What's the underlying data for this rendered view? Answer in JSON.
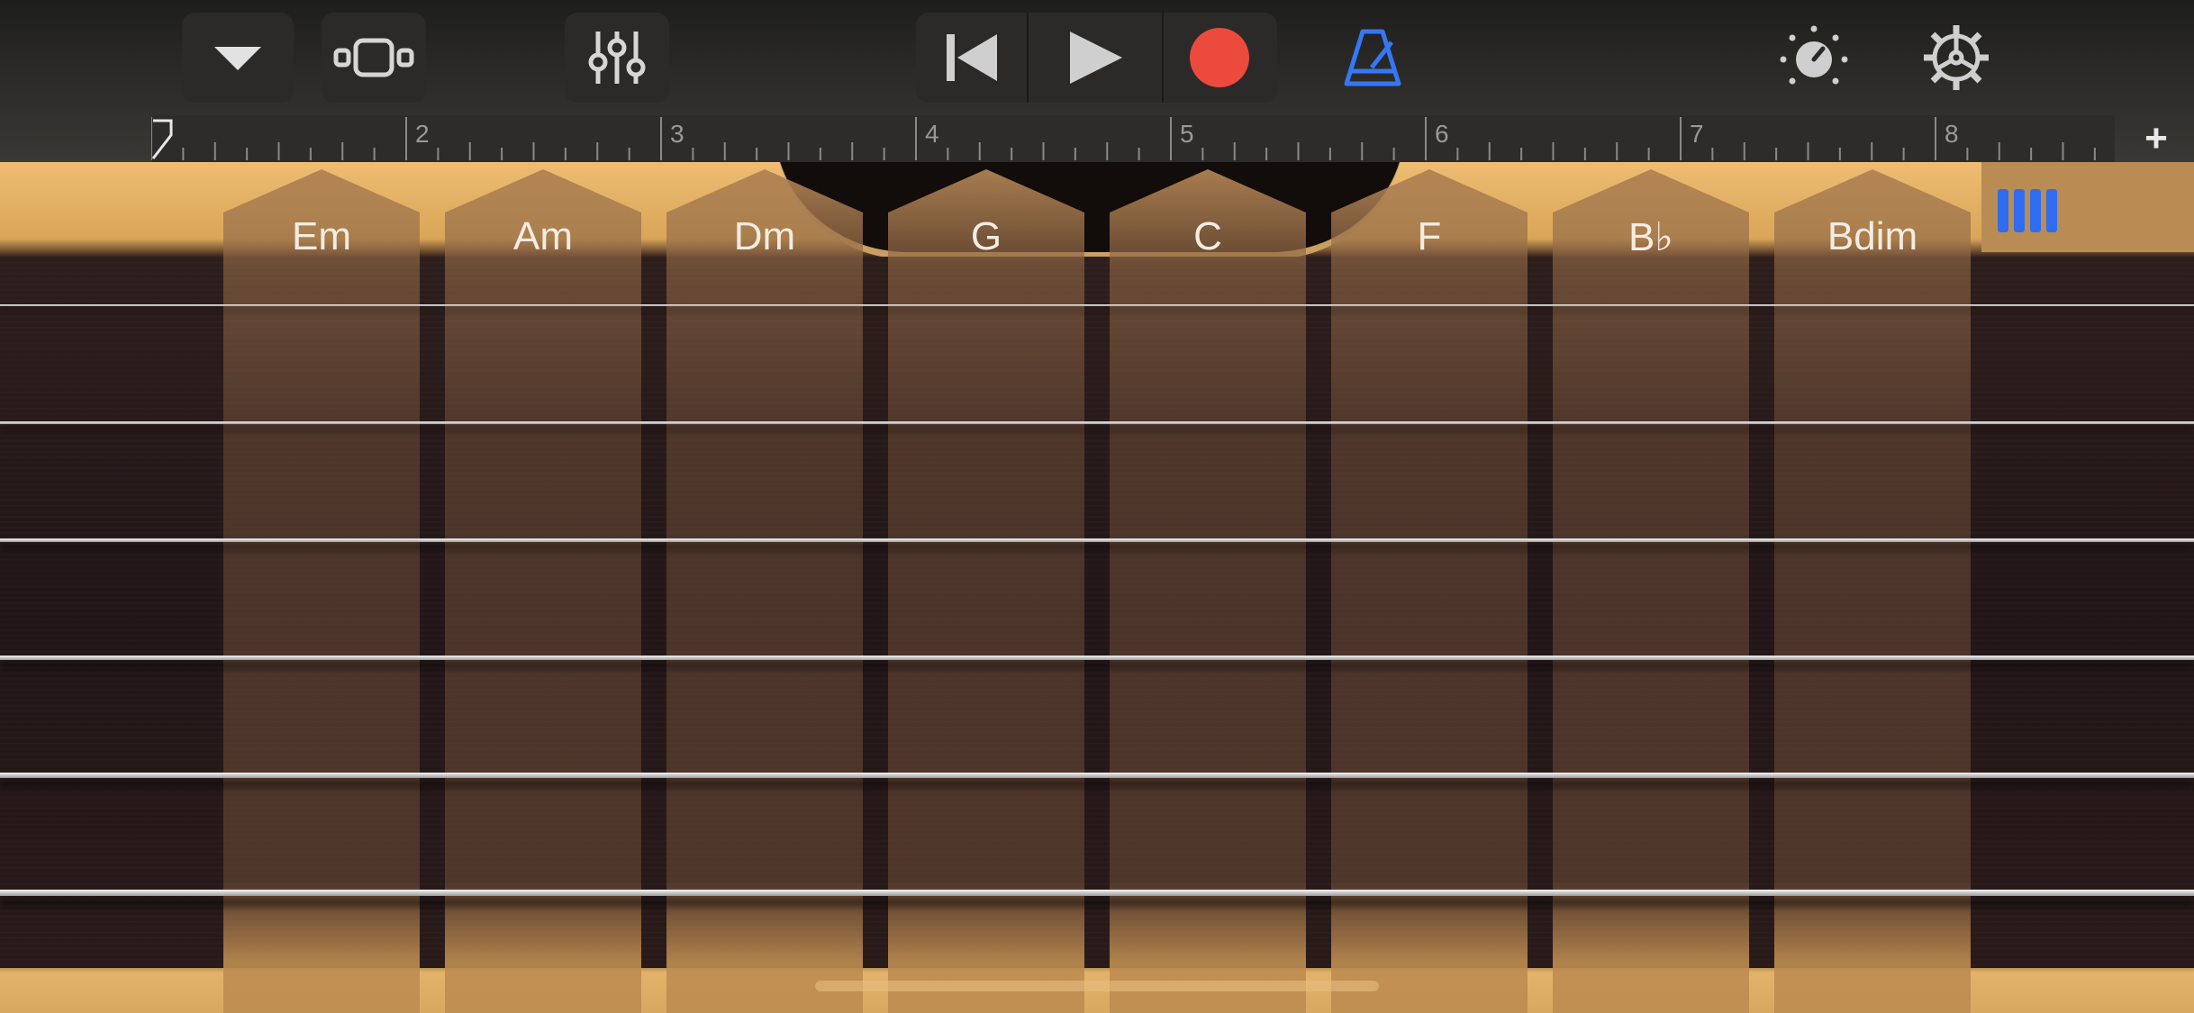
{
  "toolbar": {
    "buttons": [
      {
        "name": "browser-menu-button",
        "icon": "chevron-down-icon"
      },
      {
        "name": "tracks-view-button",
        "icon": "tracks-view-icon"
      },
      {
        "name": "mixer-button",
        "icon": "mixer-sliders-icon"
      },
      {
        "name": "go-to-beginning-button",
        "icon": "skip-back-icon"
      },
      {
        "name": "play-button",
        "icon": "play-icon"
      },
      {
        "name": "record-button",
        "icon": "record-icon"
      },
      {
        "name": "metronome-button",
        "icon": "metronome-icon"
      },
      {
        "name": "master-effects-button",
        "icon": "knob-icon"
      },
      {
        "name": "settings-button",
        "icon": "gear-icon"
      }
    ],
    "colors": {
      "record": "#ec4a3c",
      "metronome": "#3478f6",
      "icon": "#bdbdbd"
    }
  },
  "ruler": {
    "bars": [
      "2",
      "3",
      "4",
      "5",
      "6",
      "7",
      "8"
    ],
    "add_label": "+"
  },
  "chords": [
    "Em",
    "Am",
    "Dm",
    "G",
    "C",
    "F",
    "B♭",
    "Bdim"
  ],
  "strings_count": 6,
  "chord_strip_toggle": {
    "icon": "chord-strips-icon",
    "color": "#2f6cf0"
  }
}
